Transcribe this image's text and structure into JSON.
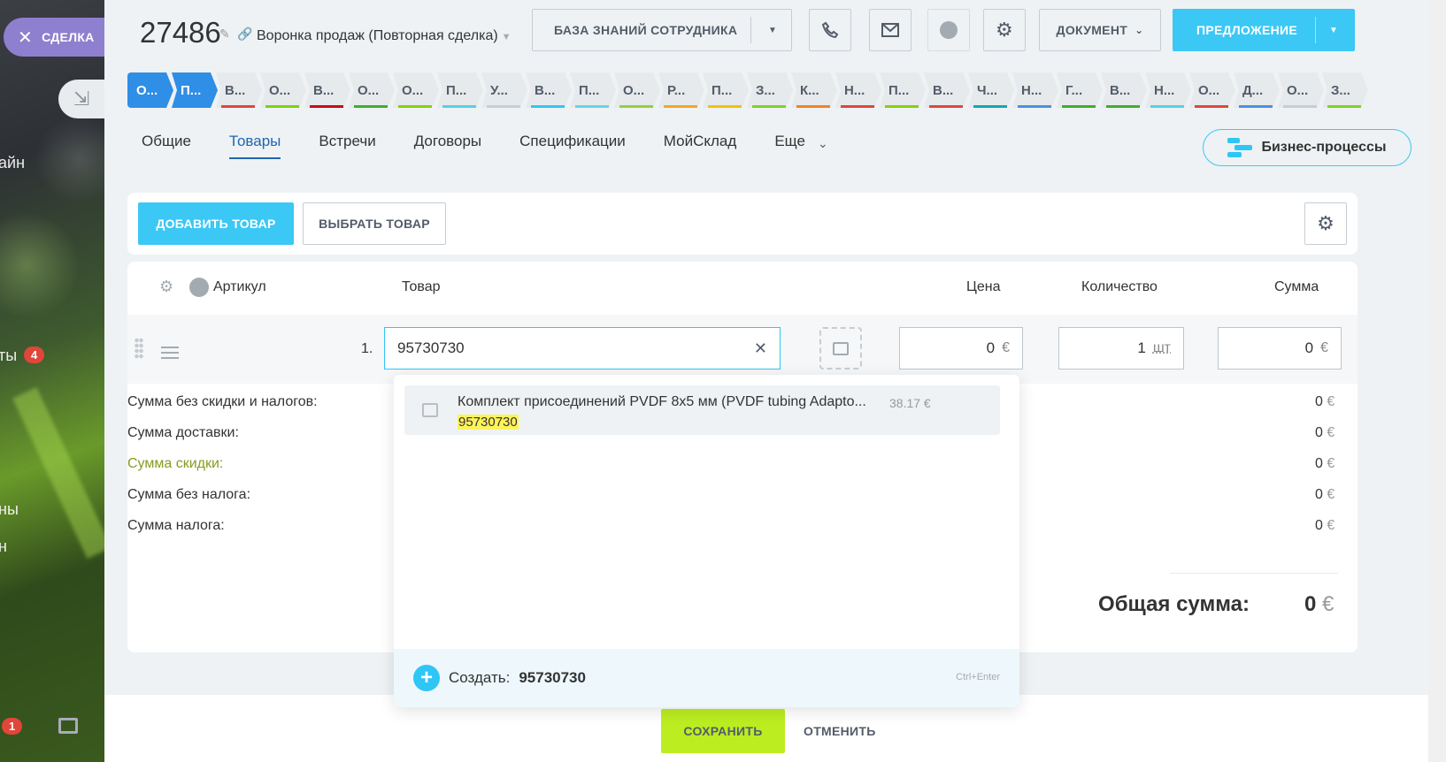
{
  "background_sidebar": {
    "texts": [
      "айн",
      "ты",
      "ны",
      "н"
    ],
    "badge_top": "4",
    "badge_bottom": "1"
  },
  "close_deal": {
    "icon": "close-icon",
    "label": "СДЕЛКА"
  },
  "header": {
    "deal_id": "27486",
    "funnel": "Воронка продаж (Повторная сделка)",
    "knowledge_base_label": "БАЗА ЗНАНИЙ СОТРУДНИКА",
    "document_label": "ДОКУМЕНТ",
    "proposal_label": "ПРЕДЛОЖЕНИЕ"
  },
  "stages": [
    {
      "label": "О...",
      "active": true,
      "color": "#2f8ee5"
    },
    {
      "label": "П...",
      "active": true,
      "color": "#2f8ee5"
    },
    {
      "label": "В...",
      "color": "#e0463a"
    },
    {
      "label": "О...",
      "color": "#7bd500"
    },
    {
      "label": "В...",
      "color": "#d0021b"
    },
    {
      "label": "О...",
      "color": "#3eaf2c"
    },
    {
      "label": "О...",
      "color": "#8ad000"
    },
    {
      "label": "П...",
      "color": "#53d2e8"
    },
    {
      "label": "У...",
      "color": "#c3ced6"
    },
    {
      "label": "В...",
      "color": "#2fc6f6"
    },
    {
      "label": "П...",
      "color": "#67d2e5"
    },
    {
      "label": "О...",
      "color": "#9acc3c"
    },
    {
      "label": "Р...",
      "color": "#f5a623"
    },
    {
      "label": "П...",
      "color": "#f2c200"
    },
    {
      "label": "З...",
      "color": "#7ed321"
    },
    {
      "label": "К...",
      "color": "#f58220"
    },
    {
      "label": "Н...",
      "color": "#e0463a"
    },
    {
      "label": "П...",
      "color": "#8ad000"
    },
    {
      "label": "В...",
      "color": "#e0463a"
    },
    {
      "label": "Ч...",
      "color": "#11a9b3"
    },
    {
      "label": "Н...",
      "color": "#4a90e2"
    },
    {
      "label": "Г...",
      "color": "#3eaf2c"
    },
    {
      "label": "В...",
      "color": "#3eaf2c"
    },
    {
      "label": "Н...",
      "color": "#53d2e8"
    },
    {
      "label": "О...",
      "color": "#e0463a"
    },
    {
      "label": "Д...",
      "color": "#4a90e2"
    },
    {
      "label": "О...",
      "color": "#c3ced6"
    },
    {
      "label": "З...",
      "color": "#7ed321"
    }
  ],
  "tabs": [
    "Общие",
    "Товары",
    "Встречи",
    "Договоры",
    "Спецификации",
    "МойСклад",
    "Еще"
  ],
  "active_tab": "Товары",
  "business_processes_label": "Бизнес-процессы",
  "toolbar": {
    "add_product": "ДОБАВИТЬ ТОВАР",
    "select_product": "ВЫБРАТЬ ТОВАР"
  },
  "table": {
    "columns": {
      "article": "Артикул",
      "product": "Товар",
      "price": "Цена",
      "quantity": "Количество",
      "sum": "Сумма"
    },
    "row": {
      "index": "1.",
      "search_value": "95730730",
      "price": "0",
      "currency": "€",
      "quantity": "1",
      "unit": "шт",
      "sum": "0"
    }
  },
  "dropdown": {
    "suggestion_name": "Комплект присоединений PVDF 8x5 мм (PVDF tubing Adapto...",
    "suggestion_price": "38.17 €",
    "suggestion_code": "95730730",
    "create_label": "Создать:",
    "create_value": "95730730",
    "shortcut": "Ctrl+Enter"
  },
  "totals": [
    {
      "label": "Сумма без скидки и налогов:",
      "value": "0"
    },
    {
      "label": "Сумма доставки:",
      "value": "0"
    },
    {
      "label": "Сумма скидки:",
      "value": "0",
      "accent": "#8a9a1f"
    },
    {
      "label": "Сумма без налога:",
      "value": "0"
    },
    {
      "label": "Сумма налога:",
      "value": "0"
    }
  ],
  "grand_total": {
    "label": "Общая сумма:",
    "value": "0",
    "currency": "€"
  },
  "footer": {
    "save": "СОХРАНИТЬ",
    "cancel": "ОТМЕНИТЬ"
  }
}
